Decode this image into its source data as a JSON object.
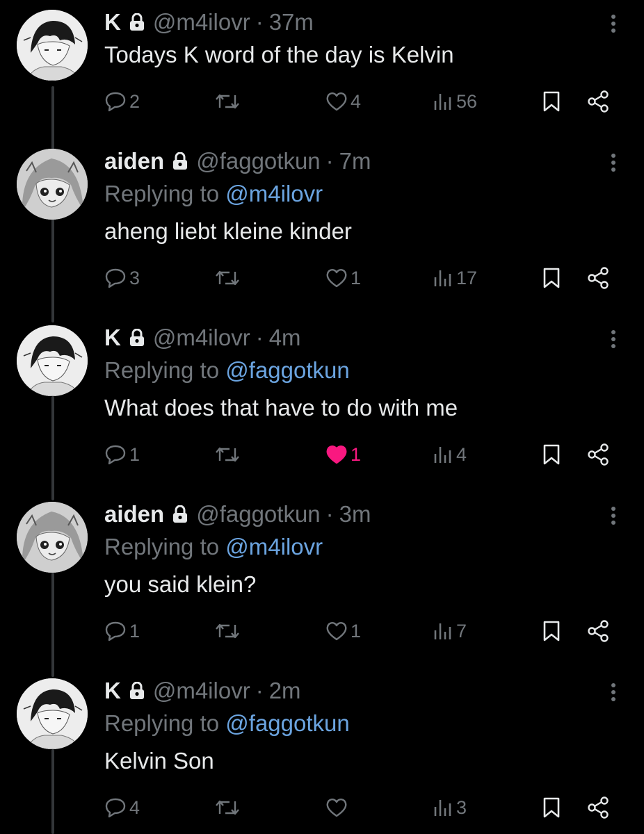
{
  "tweets": [
    {
      "author": "K",
      "handle": "@m4ilovr",
      "separator": "·",
      "time": "37m",
      "replying_label": "",
      "replying_handle": "",
      "text": "Todays K word of the day is Kelvin",
      "replies": "2",
      "retweets": "",
      "likes": "4",
      "views": "56",
      "liked": false,
      "avatar": "k-avatar"
    },
    {
      "author": "aiden",
      "handle": "@faggotkun",
      "separator": "·",
      "time": "7m",
      "replying_label": "Replying to",
      "replying_handle": "@m4ilovr",
      "text": "aheng liebt kleine kinder",
      "replies": "3",
      "retweets": "",
      "likes": "1",
      "views": "17",
      "liked": false,
      "avatar": "aiden-avatar"
    },
    {
      "author": "K",
      "handle": "@m4ilovr",
      "separator": "·",
      "time": "4m",
      "replying_label": "Replying to",
      "replying_handle": "@faggotkun",
      "text": "What does that have to do with me",
      "replies": "1",
      "retweets": "",
      "likes": "1",
      "views": "4",
      "liked": true,
      "avatar": "k-avatar"
    },
    {
      "author": "aiden",
      "handle": "@faggotkun",
      "separator": "·",
      "time": "3m",
      "replying_label": "Replying to",
      "replying_handle": "@m4ilovr",
      "text": "you said klein?",
      "replies": "1",
      "retweets": "",
      "likes": "1",
      "views": "7",
      "liked": false,
      "avatar": "aiden-avatar"
    },
    {
      "author": "K",
      "handle": "@m4ilovr",
      "separator": "·",
      "time": "2m",
      "replying_label": "Replying to",
      "replying_handle": "@faggotkun",
      "text": "Kelvin Son",
      "replies": "4",
      "retweets": "",
      "likes": "",
      "views": "3",
      "liked": false,
      "avatar": "k-avatar"
    }
  ],
  "icons": {
    "lock": "lock-icon",
    "more": "more-icon",
    "reply": "reply-icon",
    "retweet": "retweet-icon",
    "like": "heart-icon",
    "views": "views-icon",
    "bookmark": "bookmark-icon",
    "share": "share-icon"
  },
  "colors": {
    "background": "#000000",
    "text": "#e7e9ea",
    "muted": "#71767b",
    "link": "#6ba4e0",
    "liked": "#f91880",
    "thread_line": "#333639"
  }
}
